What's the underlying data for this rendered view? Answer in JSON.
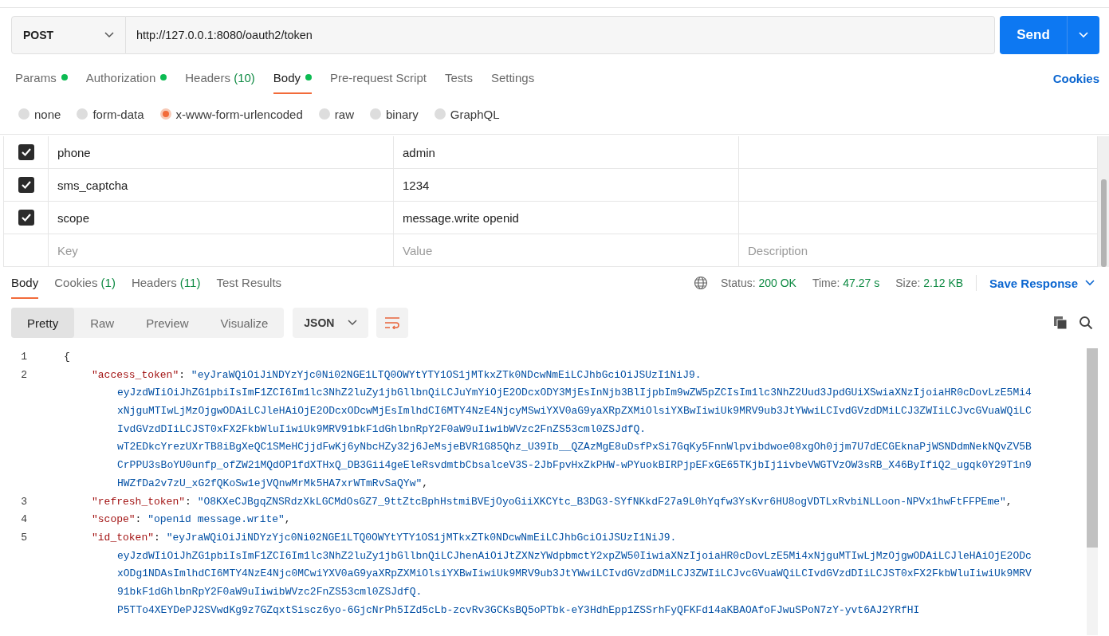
{
  "request": {
    "method": "POST",
    "url": "http://127.0.0.1:8080/oauth2/token",
    "send_label": "Send"
  },
  "request_tabs": [
    {
      "label": "Params",
      "dot": true,
      "selected": false
    },
    {
      "label": "Authorization",
      "dot": true,
      "selected": false
    },
    {
      "label": "Headers",
      "count": "(10)",
      "dot": false,
      "selected": false
    },
    {
      "label": "Body",
      "dot": true,
      "selected": true
    },
    {
      "label": "Pre-request Script",
      "dot": false,
      "selected": false
    },
    {
      "label": "Tests",
      "dot": false,
      "selected": false
    },
    {
      "label": "Settings",
      "dot": false,
      "selected": false
    }
  ],
  "cookies_link": "Cookies",
  "body_types": [
    {
      "label": "none",
      "selected": false
    },
    {
      "label": "form-data",
      "selected": false
    },
    {
      "label": "x-www-form-urlencoded",
      "selected": true
    },
    {
      "label": "raw",
      "selected": false
    },
    {
      "label": "binary",
      "selected": false
    },
    {
      "label": "GraphQL",
      "selected": false
    }
  ],
  "params": {
    "rows": [
      {
        "checked": true,
        "key": "phone",
        "value": "admin"
      },
      {
        "checked": true,
        "key": "sms_captcha",
        "value": "1234"
      },
      {
        "checked": true,
        "key": "scope",
        "value": "message.write openid"
      }
    ],
    "new_row": {
      "key": {
        "placeholder": "Key"
      },
      "value": {
        "placeholder": "Value"
      },
      "description": {
        "placeholder": "Description"
      }
    }
  },
  "response_tabs": [
    {
      "label": "Body",
      "selected": true
    },
    {
      "label": "Cookies",
      "count": "(1)",
      "selected": false
    },
    {
      "label": "Headers",
      "count": "(11)",
      "selected": false
    },
    {
      "label": "Test Results",
      "selected": false
    }
  ],
  "status": [
    {
      "label": "Status:",
      "value": "200 OK"
    },
    {
      "label": "Time:",
      "value": "47.27 s"
    },
    {
      "label": "Size:",
      "value": "2.12 KB"
    }
  ],
  "save_response": "Save Response",
  "view_modes": [
    {
      "label": "Pretty",
      "selected": true
    },
    {
      "label": "Raw",
      "selected": false
    },
    {
      "label": "Preview",
      "selected": false
    },
    {
      "label": "Visualize",
      "selected": false
    }
  ],
  "format": "JSON",
  "code_lines": [
    {
      "number": "1",
      "text": "{"
    },
    {
      "number": "2",
      "key": "\"access_token\"",
      "sep": ": ",
      "trail": ",",
      "value_lines": [
        "\"eyJraWQiOiJiNDYzYjc0Ni02NGE1LTQ0OWYtYTY1OS1jMTkxZTk0NDcwNmEiLCJhbGciOiJSUzI1NiJ9.",
        "eyJzdWIiOiJhZG1pbiIsImF1ZCI6Im1lc3NhZ2luZy1jbGllbnQiLCJuYmYiOjE2ODcxODY3MjEsInNjb3BlIjpbIm9wZW5pZCIsIm1lc3NhZ2Uud3JpdGUiXSwiaXNzIjoiaHR0cDovLzE5Mi4",
        "xNjguMTIwLjMzOjgwODAiLCJleHAiOjE2ODcxODcwMjEsImlhdCI6MTY4NzE4NjcyMSwiYXV0aG9yaXRpZXMiOlsiYXBwIiwiUk9MRV9ub3JtYWwiLCIvdGVzdDMiLCJ3ZWIiLCJvcGVuaWQiLC",
        "IvdGVzdDIiLCJST0xFX2FkbWluIiwiUk9MRV91bkF1dGhlbnRpY2F0aW9uIiwibWVzc2FnZS53cml0ZSJdfQ.",
        "wT2EDkcYrezUXrTB8iBgXeQC1SMeHCjjdFwKj6yNbcHZy32j6JeMsjeBVR1G85Qhz_U39Ib__QZAzMgE8uDsfPxSi7GqKy5FnnWlpvibdwoe08xgOh0jjm7U7dECGEknaPjWSNDdmNekNQvZV5B",
        "CrPPU3sBoYU0unfp_ofZW21MQdOP1fdXTHxQ_DB3Gii4geEleRsvdmtbCbsalceV3S-2JbFpvHxZkPHW-wPYuokBIRPjpEFxGE65TKjbIj1ivbeVWGTVzOW3sRB_X46ByIfiQ2_ugqk0Y29T1n9",
        "HWZfDa2v7zU_xG2fQKoSw1ejVQnwMrMk5HA7xrWTmRvSaQYw\""
      ]
    },
    {
      "number": "3",
      "key": "\"refresh_token\"",
      "sep": ": ",
      "trail": ",",
      "value_lines": [
        "\"O8KXeCJBgqZNSRdzXkLGCMdOsGZ7_9ttZtcBphHstmiBVEjOyoGiiXKCYtc_B3DG3-SYfNKkdF27a9L0hYqfw3YsKvr6HU8ogVDTLxRvbiNLLoon-NPVx1hwFtFFPEme\""
      ]
    },
    {
      "number": "4",
      "key": "\"scope\"",
      "sep": ": ",
      "trail": ",",
      "value_lines": [
        "\"openid message.write\""
      ]
    },
    {
      "number": "5",
      "key": "\"id_token\"",
      "sep": ": ",
      "value_lines": [
        "\"eyJraWQiOiJiNDYzYjc0Ni02NGE1LTQ0OWYtYTY1OS1jMTkxZTk0NDcwNmEiLCJhbGciOiJSUzI1NiJ9.",
        "eyJzdWIiOiJhZG1pbiIsImF1ZCI6Im1lc3NhZ2luZy1jbGllbnQiLCJhenAiOiJtZXNzYWdpbmctY2xpZW50IiwiaXNzIjoiaHR0cDovLzE5Mi4xNjguMTIwLjMzOjgwODAiLCJleHAiOjE2ODc",
        "xODg1NDAsImlhdCI6MTY4NzE4Njc0MCwiYXV0aG9yaXRpZXMiOlsiYXBwIiwiUk9MRV9ub3JtYWwiLCIvdGVzdDMiLCJ3ZWIiLCJvcGVuaWQiLCIvdGVzdDIiLCJST0xFX2FkbWluIiwiUk9MRV",
        "91bkF1dGhlbnRpY2F0aW9uIiwibWVzc2FnZS53cml0ZSJdfQ.",
        "P5TTo4XEYDePJ2SVwdKg9z7GZqxtSiscz6yo-6GjcNrPh5IZd5cLb-zcvRv3GCKsBQ5oPTbk-eY3HdhEpp1ZSSrhFyQFKFd14aKBAOAfoFJwuSPoN7zY-yvt6AJ2YRfHI"
      ]
    }
  ]
}
